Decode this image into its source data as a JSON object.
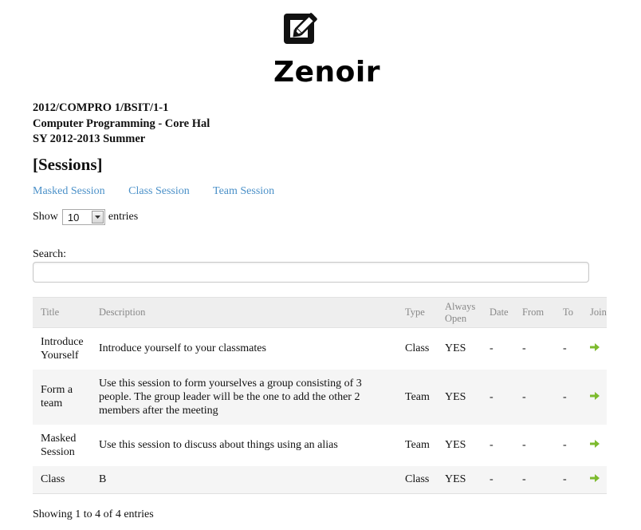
{
  "brand": {
    "name": "Zenoir",
    "logo_icon": "edit-icon"
  },
  "course": {
    "code": "2012/COMPRO 1/BSIT/1-1",
    "name": "Computer Programming - Core Hal",
    "term": "SY 2012-2013 Summer"
  },
  "section_title": "[Sessions]",
  "links": {
    "masked": "Masked Session",
    "class": "Class Session",
    "team": "Team Session"
  },
  "length_menu": {
    "show": "Show",
    "value": "10",
    "entries": "entries"
  },
  "search": {
    "label": "Search:",
    "value": "",
    "placeholder": ""
  },
  "table": {
    "headers": {
      "title": "Title",
      "description": "Description",
      "type": "Type",
      "always_open": "Always Open",
      "date": "Date",
      "from": "From",
      "to": "To",
      "join": "Join"
    },
    "rows": [
      {
        "title": "Introduce Yourself",
        "description": "Introduce yourself to your classmates",
        "type": "Class",
        "always_open": "YES",
        "date": "-",
        "from": "-",
        "to": "-"
      },
      {
        "title": "Form a team",
        "description": "Use this session to form yourselves a group consisting of 3 people. The group leader will be the one to add the other 2 members after the meeting",
        "type": "Team",
        "always_open": "YES",
        "date": "-",
        "from": "-",
        "to": "-"
      },
      {
        "title": "Masked Session",
        "description": "Use this session to discuss about things using an alias",
        "type": "Team",
        "always_open": "YES",
        "date": "-",
        "from": "-",
        "to": "-"
      },
      {
        "title": "Class",
        "description": "B",
        "type": "Class",
        "always_open": "YES",
        "date": "-",
        "from": "-",
        "to": "-"
      }
    ]
  },
  "info": "Showing 1 to 4 of 4 entries",
  "colors": {
    "link": "#4a90c8",
    "join_arrow": "#7dbb2e",
    "header_bg": "#eeeeee",
    "row_alt_bg": "#f5f5f5"
  }
}
